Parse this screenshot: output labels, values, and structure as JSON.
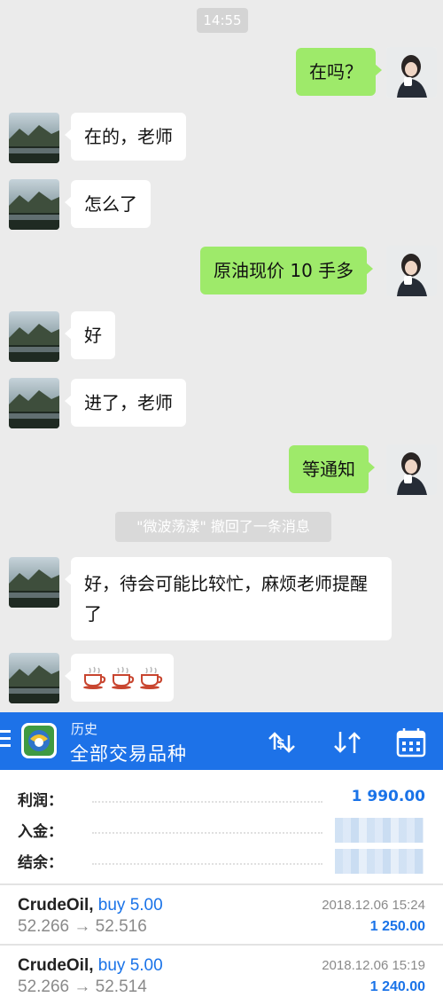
{
  "chat": {
    "time": "14:55",
    "messages": [
      {
        "side": "out",
        "text": "在吗？"
      },
      {
        "side": "in",
        "text": "在的，老师"
      },
      {
        "side": "in",
        "text": "怎么了"
      },
      {
        "side": "out",
        "text": "原油现价 10 手多"
      },
      {
        "side": "in",
        "text": "好"
      },
      {
        "side": "in",
        "text": "进了，老师"
      },
      {
        "side": "out",
        "text": "等通知"
      },
      {
        "side": "in",
        "text": "好，待会可能比较忙，麻烦老师提醒了"
      },
      {
        "side": "in",
        "text": "",
        "emoji": [
          "coffee-cup",
          "coffee-cup",
          "coffee-cup"
        ]
      }
    ],
    "recall_notice": "\"微波荡漾\" 撤回了一条消息"
  },
  "header": {
    "subtitle": "历史",
    "title": "全部交易品种",
    "icons": [
      "menu-icon",
      "app-logo-icon",
      "currency-exchange-icon",
      "sort-icon",
      "calendar-icon"
    ],
    "color": "#1d72e8"
  },
  "summary": {
    "profit_label": "利润：",
    "profit_value": "1 990.00",
    "deposit_label": "入金：",
    "balance_label": "结余："
  },
  "trades": [
    {
      "symbol": "CrudeOil,",
      "side": "buy 5.00",
      "prices": "52.266 → 52.516",
      "date": "2018.12.06 15:24",
      "profit": "1 250.00"
    },
    {
      "symbol": "CrudeOil,",
      "side": "buy 5.00",
      "prices": "52.266 → 52.514",
      "date": "2018.12.06 15:19",
      "profit": "1 240.00"
    }
  ],
  "colors": {
    "accent_blue": "#1a73e8",
    "bubble_green": "#9eea6a",
    "chat_bg": "#ebebeb"
  }
}
